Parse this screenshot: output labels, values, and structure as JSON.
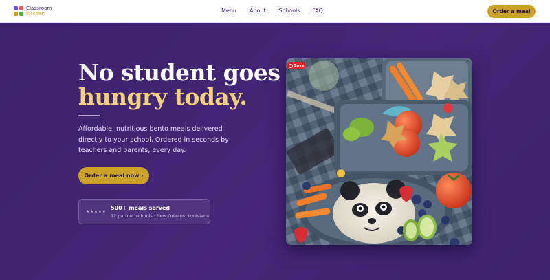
{
  "brand": {
    "line1": "Classroom",
    "line2": "Kitchen",
    "colors": [
      "#7b4fd1",
      "#e85c5c",
      "#c9a227",
      "#4caf50"
    ]
  },
  "nav": {
    "links": [
      "Menu",
      "About",
      "Schools",
      "FAQ"
    ],
    "cta": "Order a meal"
  },
  "hero": {
    "title_line1": "No student goes",
    "title_line2": "hungry today.",
    "description": "Affordable, nutritious bento meals delivered directly to your school. Ordered in seconds by teachers and parents, every day.",
    "cta": "Order a meal now ›"
  },
  "stats": {
    "stars": "★★★★★",
    "title": "500+ meals served",
    "subtitle": "12 partner schools · New Orleans, Louisiana"
  },
  "photo": {
    "save_label": "Save"
  },
  "colors": {
    "background": "#3d2270",
    "accent": "#c9a227",
    "title_highlight": "#f3d27a"
  }
}
